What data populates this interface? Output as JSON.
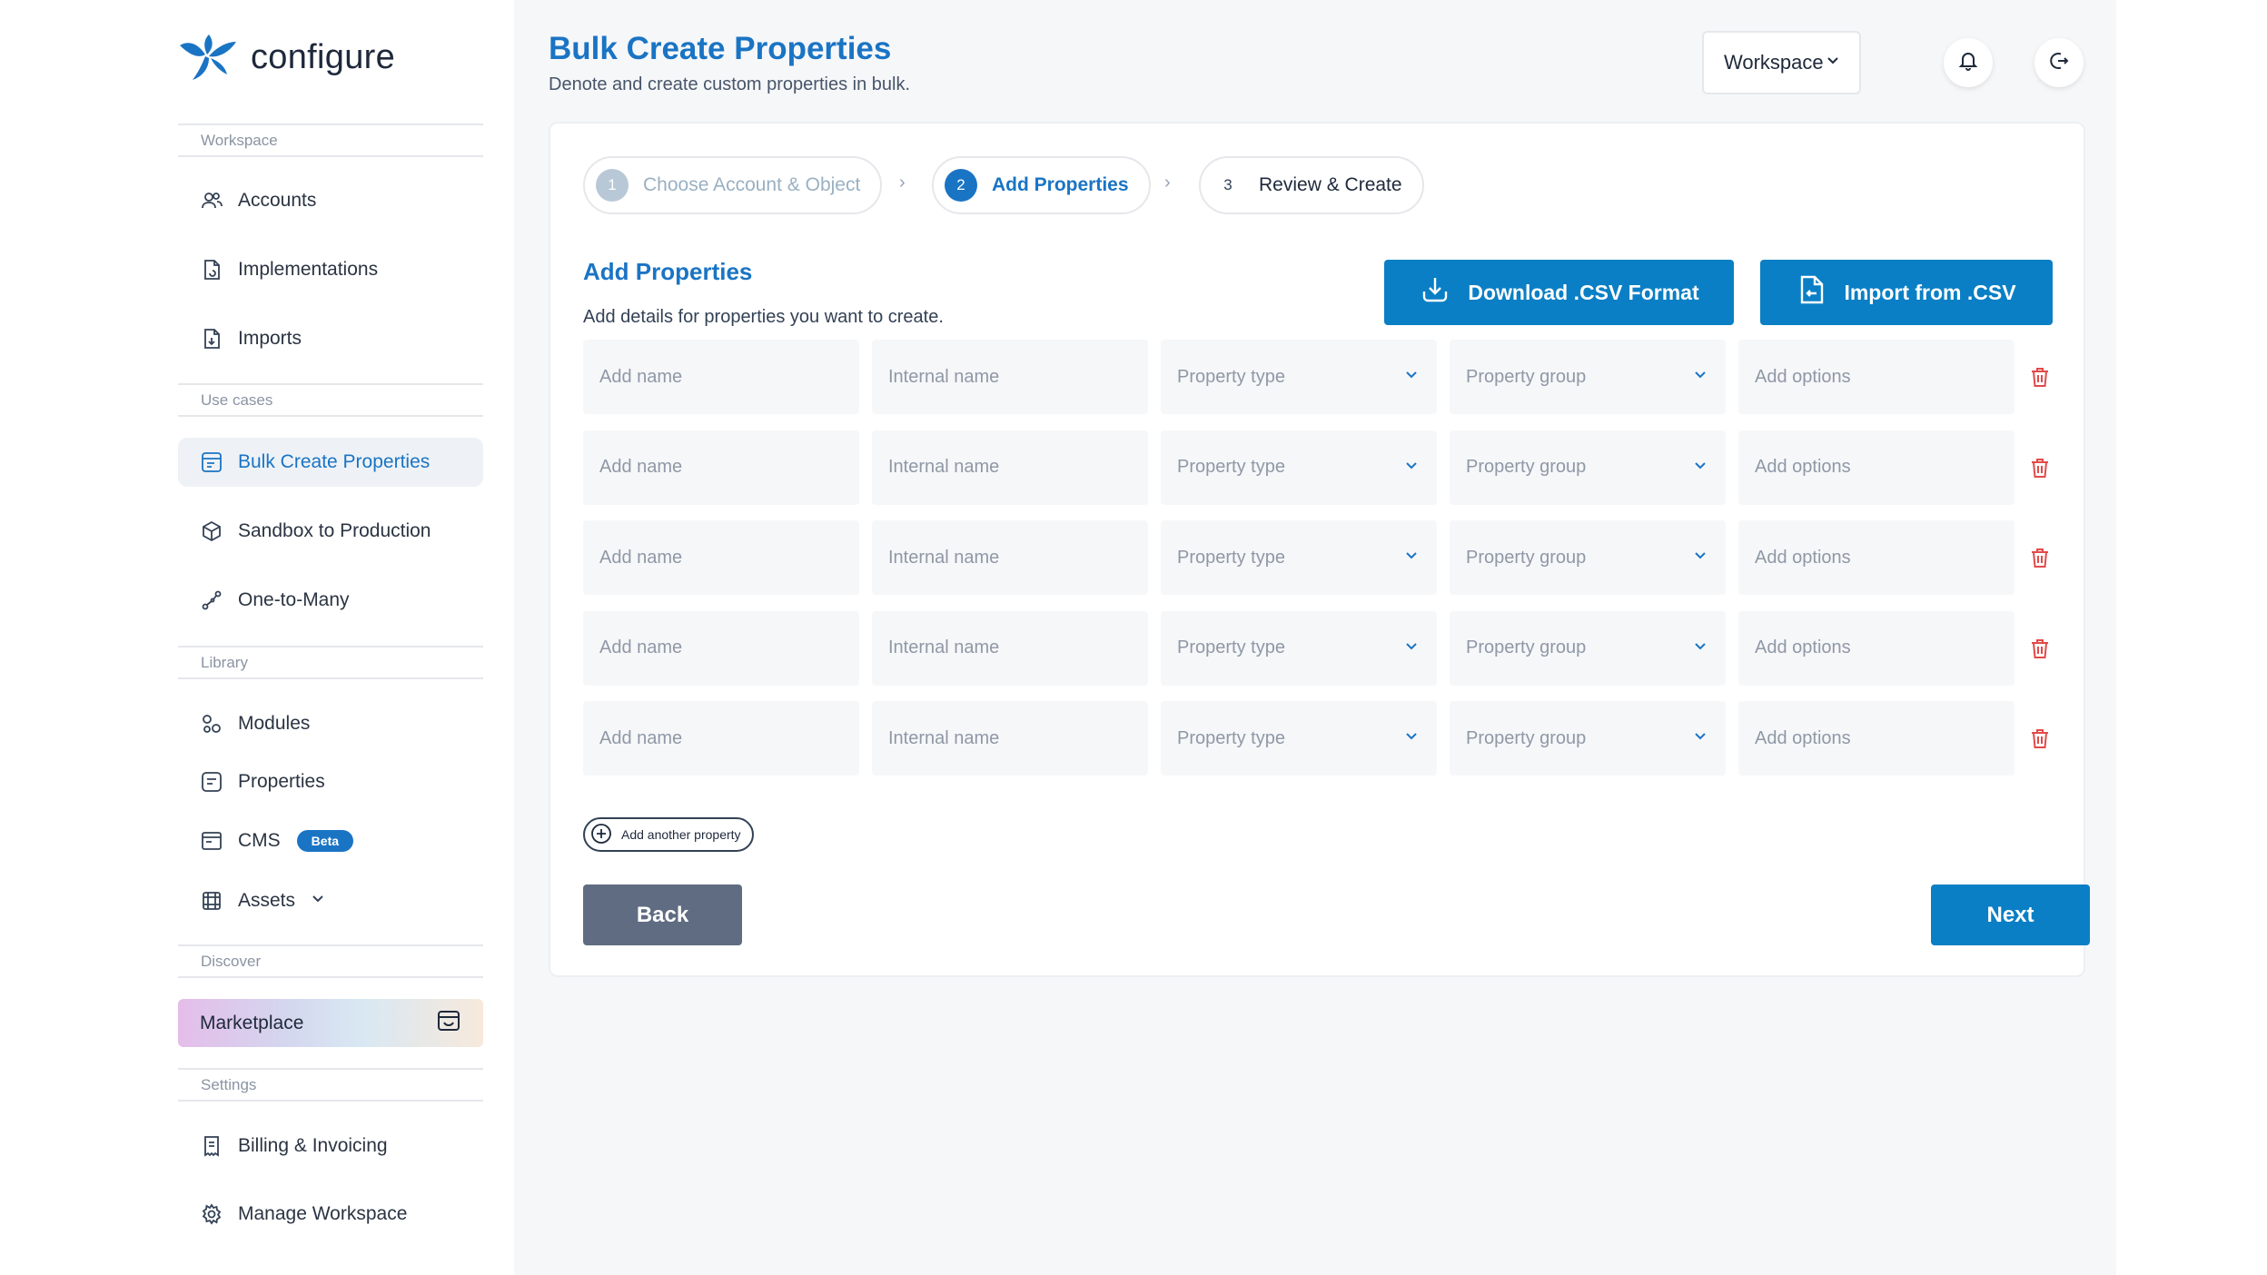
{
  "brand": {
    "name": "configure",
    "accent": "#1a74c4",
    "primary_button": "#0a7fc5"
  },
  "sidebar": {
    "sections": [
      {
        "label": "Workspace"
      },
      {
        "label": "Use cases"
      },
      {
        "label": "Library"
      },
      {
        "label": "Discover"
      },
      {
        "label": "Settings"
      }
    ],
    "items": [
      {
        "label": "Accounts",
        "icon": "users-icon"
      },
      {
        "label": "Implementations",
        "icon": "file-refresh-icon"
      },
      {
        "label": "Imports",
        "icon": "file-import-icon"
      },
      {
        "label": "Bulk Create Properties",
        "icon": "list-edit-icon",
        "active": true
      },
      {
        "label": "Sandbox to Production",
        "icon": "cube-icon"
      },
      {
        "label": "One-to-Many",
        "icon": "share-nodes-icon"
      },
      {
        "label": "Modules",
        "icon": "modules-icon"
      },
      {
        "label": "Properties",
        "icon": "properties-icon"
      },
      {
        "label": "CMS",
        "icon": "cms-icon",
        "badge": "Beta"
      },
      {
        "label": "Assets",
        "icon": "assets-icon"
      },
      {
        "label": "Billing & Invoicing",
        "icon": "receipt-icon"
      },
      {
        "label": "Manage Workspace",
        "icon": "gear-icon"
      }
    ],
    "marketplace": {
      "label": "Marketplace",
      "icon": "store-icon"
    }
  },
  "header": {
    "title": "Bulk Create Properties",
    "subtitle": "Denote and create custom properties in bulk.",
    "workspace_select": "Workspace"
  },
  "stepper": [
    {
      "num": "1",
      "label": "Choose Account & Object",
      "state": "done"
    },
    {
      "num": "2",
      "label": "Add Properties",
      "state": "current"
    },
    {
      "num": "3",
      "label": "Review & Create",
      "state": "todo"
    }
  ],
  "section": {
    "title": "Add Properties",
    "subtitle": "Add details for properties you want to create.",
    "download_btn": "Download .CSV Format",
    "import_btn": "Import from .CSV"
  },
  "row_placeholders": {
    "name": "Add name",
    "internal": "Internal name",
    "type": "Property type",
    "group": "Property group",
    "options": "Add options"
  },
  "rows": [
    {},
    {},
    {},
    {},
    {}
  ],
  "add_another": "Add another property",
  "back_btn": "Back",
  "next_btn": "Next"
}
